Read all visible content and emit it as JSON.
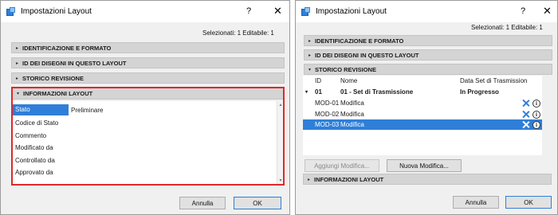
{
  "left_dialog": {
    "title": "Impostazioni Layout",
    "help_glyph": "?",
    "close_glyph": "✕",
    "selection_info": "Selezionati: 1 Editabile: 1",
    "sections": {
      "identification": "IDENTIFICAZIONE E FORMATO",
      "drawing_ids": "ID DEI DISEGNI IN QUESTO LAYOUT",
      "revision_history": "STORICO REVISIONE",
      "layout_info": "INFORMAZIONI LAYOUT"
    },
    "properties": [
      {
        "label": "Stato",
        "value": "Preliminare"
      },
      {
        "label": "Codice di Stato",
        "value": ""
      },
      {
        "label": "Commento",
        "value": ""
      },
      {
        "label": "Modificato da",
        "value": ""
      },
      {
        "label": "Controllato da",
        "value": ""
      },
      {
        "label": "Approvato da",
        "value": ""
      }
    ],
    "cancel_label": "Annulla",
    "ok_label": "OK"
  },
  "right_dialog": {
    "title": "Impostazioni Layout",
    "help_glyph": "?",
    "close_glyph": "✕",
    "selection_info": "Selezionati: 1 Editabile: 1",
    "sections": {
      "identification": "IDENTIFICAZIONE E FORMATO",
      "drawing_ids": "ID DEI DISEGNI IN QUESTO LAYOUT",
      "revision_history": "STORICO REVISIONE",
      "layout_info": "INFORMAZIONI LAYOUT"
    },
    "table": {
      "headers": {
        "id": "ID",
        "name": "Nome",
        "date": "Data Set di Trasmission"
      },
      "group": {
        "expander": "▾",
        "id": "01",
        "name": "01 - Set di Trasmissione",
        "status": "In Progresso"
      },
      "rows": [
        {
          "id": "MOD-01",
          "name": "Modifica"
        },
        {
          "id": "MOD-02",
          "name": "Modifica"
        },
        {
          "id": "MOD-03",
          "name": "Modifica"
        }
      ]
    },
    "add_change_label": "Aggiungi Modifica...",
    "new_change_label": "Nuova Modifica...",
    "cancel_label": "Annulla",
    "ok_label": "OK"
  },
  "colors": {
    "accent": "#2f7fd8",
    "highlight_border": "#e02828",
    "section_bg": "#d4d4d4",
    "dialog_bg": "#f0f0f0"
  },
  "icons": [
    "app-icon",
    "help-icon",
    "close-icon",
    "collapse-arrow-icon",
    "expand-arrow-icon",
    "delete-x-icon",
    "info-icon"
  ]
}
